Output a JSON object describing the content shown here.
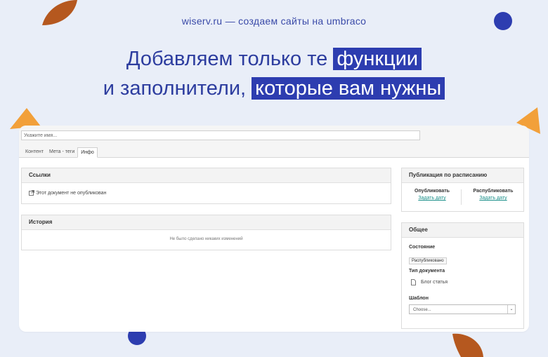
{
  "banner": {
    "site_url": "wiserv.ru — создаем сайты на umbraco",
    "headline_line1_plain": "Добавляем только те",
    "headline_line1_highlight": "функции",
    "headline_line2_plain": "и заполнители,",
    "headline_line2_highlight": "которые вам нужны"
  },
  "editor": {
    "name_placeholder": "Укажите имя...",
    "tabs": [
      {
        "label": "Контент"
      },
      {
        "label": "Мета - теги"
      },
      {
        "label": "Инфо"
      }
    ],
    "active_tab": "Инфо"
  },
  "links_panel": {
    "title": "Ссылки",
    "status_text": "Этот документ не опубликован",
    "status_icon": "external-link-icon"
  },
  "history_panel": {
    "title": "История",
    "empty_text": "Не было сделано никаких изменений"
  },
  "schedule_panel": {
    "title": "Публикация по расписанию",
    "unpublish_label": "Опубликовать",
    "unpublish_link": "Задать дату",
    "publish_label": "Распубликовать",
    "publish_link": "Задать дату"
  },
  "general_panel": {
    "title": "Общее",
    "state_label": "Состояние",
    "state_value": "Распубликовано",
    "doctype_label": "Тип документа",
    "doctype_value": "Блог статья",
    "doctype_icon": "document-icon",
    "template_label": "Шаблон",
    "template_value": "Choose..."
  },
  "colors": {
    "background": "#e9eef8",
    "brand_blue": "#2d3db0",
    "accent_orange": "#f2a03a",
    "accent_brown": "#b5581f",
    "link_teal": "#1a8f89"
  }
}
